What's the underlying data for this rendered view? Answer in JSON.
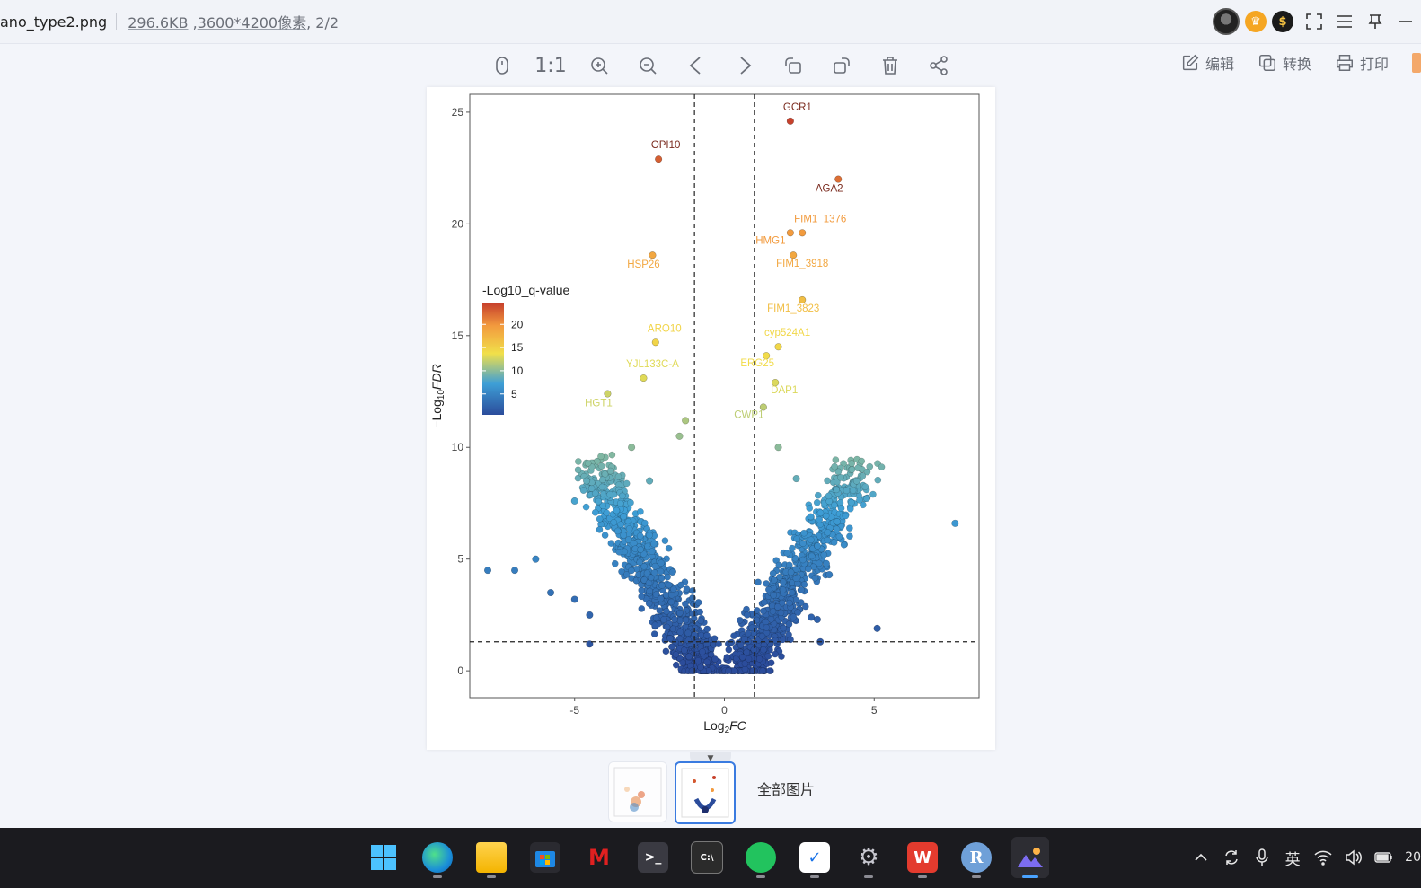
{
  "window": {
    "filename": "ano_type2.png",
    "size": "296.6KB",
    "dimensions": "3600*4200像素",
    "page": ", 2/2"
  },
  "toolbar": {
    "tools": [
      {
        "name": "mouse-mode-icon"
      },
      {
        "name": "actual-size-icon",
        "label": "1:1"
      },
      {
        "name": "zoom-in-icon"
      },
      {
        "name": "zoom-out-icon"
      },
      {
        "name": "previous-icon"
      },
      {
        "name": "next-icon"
      },
      {
        "name": "rotate-left-icon"
      },
      {
        "name": "rotate-right-icon"
      },
      {
        "name": "delete-icon"
      },
      {
        "name": "share-icon"
      }
    ],
    "edit_label": "编辑",
    "convert_label": "转换",
    "print_label": "打印"
  },
  "thumbnails": {
    "all_images_label": "全部图片",
    "selected_index": 1
  },
  "taskbar": {
    "apps": [
      "start",
      "edge",
      "file-explorer",
      "store",
      "mcafee",
      "terminal",
      "cmd",
      "wechat",
      "task-app",
      "settings",
      "wps",
      "r",
      "photos"
    ],
    "ime_label": "英",
    "clock": "20"
  },
  "chart_data": {
    "type": "scatter",
    "title": "",
    "xlabel": "Log2FC",
    "ylabel": "-Log10FDR",
    "xlim": [
      -8.5,
      8.5
    ],
    "ylim": [
      -1.2,
      25.8
    ],
    "x_ticks": [
      -5,
      0,
      5
    ],
    "y_ticks": [
      0,
      5,
      10,
      15,
      20,
      25
    ],
    "thresholds": {
      "x": [
        -1,
        1
      ],
      "y": 1.3
    },
    "grid": false,
    "legend": {
      "title": "-Log10_q-value",
      "position": "left-inside",
      "ticks": [
        20,
        15,
        10,
        5
      ],
      "colors": [
        "#2b4c9b",
        "#3e9fd6",
        "#f1e04a",
        "#f29a3e",
        "#c7412c"
      ]
    },
    "labeled_points": [
      {
        "label": "GCR1",
        "x": 2.2,
        "y": 24.6
      },
      {
        "label": "OPI10",
        "x": -2.2,
        "y": 22.9
      },
      {
        "label": "AGA2",
        "x": 3.8,
        "y": 22.0
      },
      {
        "label": "FIM1_1376",
        "x": 2.6,
        "y": 19.6
      },
      {
        "label": "HMG1",
        "x": 2.2,
        "y": 19.6
      },
      {
        "label": "FIM1_3918",
        "x": 2.3,
        "y": 18.6
      },
      {
        "label": "HSP26",
        "x": -2.4,
        "y": 18.6
      },
      {
        "label": "FIM1_3823",
        "x": 2.6,
        "y": 16.6
      },
      {
        "label": "ARO10",
        "x": -2.3,
        "y": 14.7
      },
      {
        "label": "cyp524A1",
        "x": 1.8,
        "y": 14.5
      },
      {
        "label": "ERG25",
        "x": 1.4,
        "y": 14.1
      },
      {
        "label": "YJL133C-A",
        "x": -2.7,
        "y": 13.1
      },
      {
        "label": "DAP1",
        "x": 1.7,
        "y": 12.9
      },
      {
        "label": "HGT1",
        "x": -3.9,
        "y": 12.4
      },
      {
        "label": "CWP1",
        "x": 1.3,
        "y": 11.8
      }
    ],
    "other_points": [
      {
        "x": 7.7,
        "y": 6.6
      },
      {
        "x": 5.1,
        "y": 1.9
      },
      {
        "x": -7.9,
        "y": 4.5
      },
      {
        "x": -7.0,
        "y": 4.5
      },
      {
        "x": -6.3,
        "y": 5.0
      },
      {
        "x": -5.8,
        "y": 3.5
      },
      {
        "x": -5.0,
        "y": 3.2
      },
      {
        "x": -4.5,
        "y": 2.5
      },
      {
        "x": -4.5,
        "y": 1.2
      },
      {
        "x": -5.0,
        "y": 7.6
      },
      {
        "x": -4.6,
        "y": 8.5
      },
      {
        "x": -3.1,
        "y": 10.0
      },
      {
        "x": -2.5,
        "y": 8.5
      },
      {
        "x": -1.5,
        "y": 10.5
      },
      {
        "x": -1.3,
        "y": 11.2
      },
      {
        "x": 3.4,
        "y": 4.8
      },
      {
        "x": 3.5,
        "y": 4.3
      },
      {
        "x": 2.9,
        "y": 2.4
      },
      {
        "x": 3.1,
        "y": 2.3
      },
      {
        "x": 3.2,
        "y": 1.3
      },
      {
        "x": 1.8,
        "y": 10.0
      },
      {
        "x": 2.4,
        "y": 8.6
      }
    ]
  }
}
